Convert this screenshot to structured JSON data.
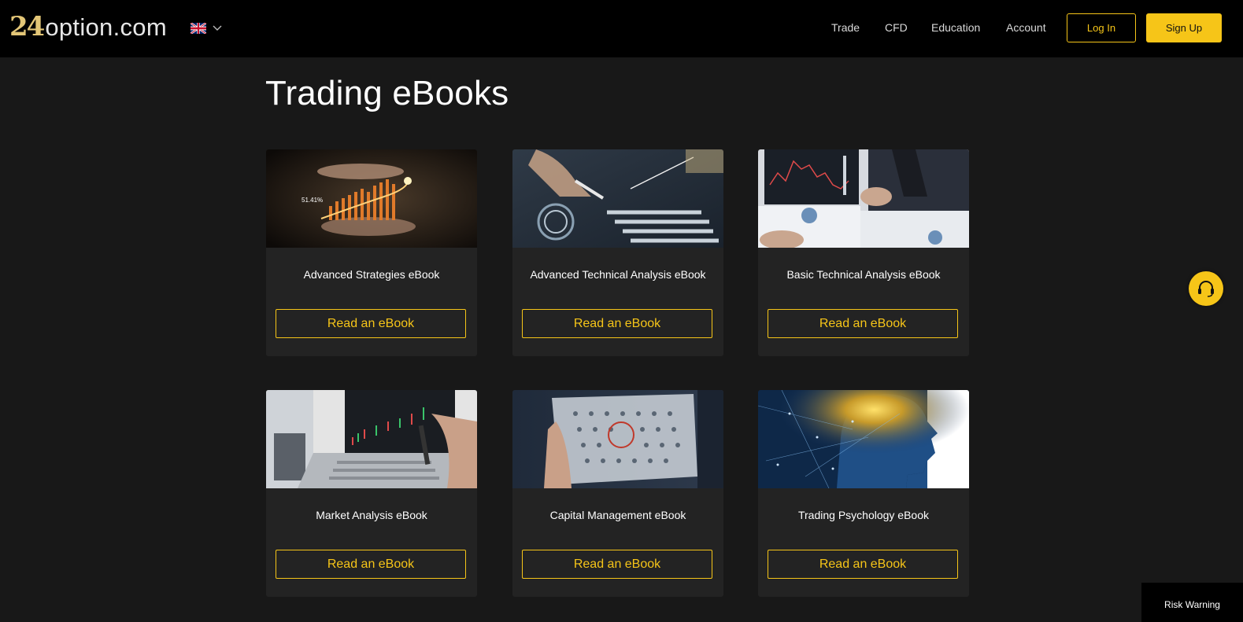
{
  "brand": {
    "logo_number": "24",
    "logo_text": "option.com"
  },
  "language": {
    "flag_icon": "uk-flag-icon",
    "chevron_icon": "chevron-down-icon"
  },
  "nav": {
    "items": [
      {
        "label": "Trade"
      },
      {
        "label": "CFD"
      },
      {
        "label": "Education"
      },
      {
        "label": "Account"
      }
    ],
    "login_label": "Log In",
    "signup_label": "Sign Up"
  },
  "colors": {
    "accent": "#f6c518",
    "background": "#181818",
    "card": "#232323",
    "header": "#000000"
  },
  "page": {
    "title": "Trading eBooks"
  },
  "ebooks": [
    {
      "title": "Advanced Strategies eBook",
      "button": "Read an eBook",
      "image_icon": "trading-chart-hands-image"
    },
    {
      "title": "Advanced Technical Analysis eBook",
      "button": "Read an eBook",
      "image_icon": "analytics-pen-image"
    },
    {
      "title": "Basic Technical Analysis eBook",
      "button": "Read an eBook",
      "image_icon": "chart-documents-image"
    },
    {
      "title": "Market Analysis eBook",
      "button": "Read an eBook",
      "image_icon": "laptop-chart-image"
    },
    {
      "title": "Capital Management eBook",
      "button": "Read an eBook",
      "image_icon": "tablet-people-image"
    },
    {
      "title": "Trading Psychology eBook",
      "button": "Read an eBook",
      "image_icon": "digital-head-image"
    }
  ],
  "support": {
    "icon": "headset-icon"
  },
  "risk": {
    "label": "Risk Warning"
  }
}
